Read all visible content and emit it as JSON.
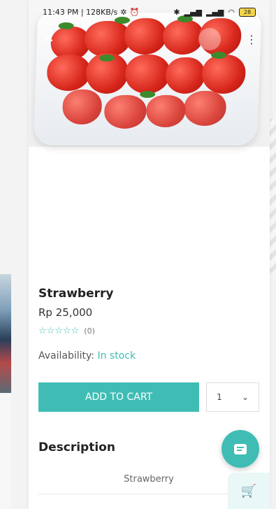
{
  "status_bar": {
    "time_info": "11:43 PM | 128KB/s",
    "battery": "28"
  },
  "product": {
    "name": "Strawberry",
    "price": "Rp 25,000",
    "rating_stars": "☆☆☆☆☆",
    "rating_count": "(0)",
    "availability_label": "Availability:",
    "availability_value": "In stock"
  },
  "actions": {
    "add_to_cart": "ADD TO CART",
    "quantity": "1"
  },
  "description": {
    "heading": "Description",
    "text": "Strawberry"
  },
  "icons": {
    "close": "close-icon",
    "more": "more-vertical-icon",
    "chat": "chat-icon",
    "cart": "cart-add-icon"
  },
  "colors": {
    "accent": "#3fbdb5"
  }
}
